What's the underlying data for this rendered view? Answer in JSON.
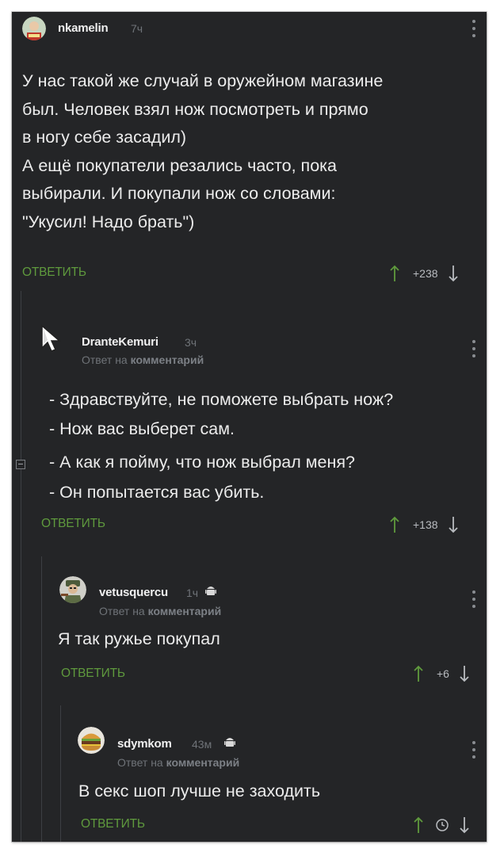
{
  "colors": {
    "background": "#242527",
    "reply_green": "#5f9a3d",
    "username": "#f0f0f0",
    "muted": "#6f7378",
    "body_text": "#ececec"
  },
  "comments": [
    {
      "username": "nkamelin",
      "time": "7ч",
      "avatar_icon": "user-avatar-icon",
      "lines": [
        "У нас такой же случай в оружейном магазине",
        "был. Человек взял нож посмотреть и прямо",
        "в ногу себе засадил)",
        "А ещё покупатели резались часто, пока",
        "выбирали. И покупали нож со словами:",
        "\"Укусил! Надо брать\")"
      ],
      "reply_label": "ОТВЕТИТЬ",
      "score": "+238"
    },
    {
      "username": "DranteKemuri",
      "time": "3ч",
      "avatar_icon": "cursor-avatar-icon",
      "reply_to_prefix": "Ответ на",
      "reply_to_target": "комментарий",
      "lines": [
        "- Здравствуйте, не поможете выбрать нож?",
        "- Нож вас выберет сам.",
        "- А как я пойму, что нож выбрал меня?",
        "- Он попытается вас убить."
      ],
      "reply_label": "ОТВЕТИТЬ",
      "score": "+138"
    },
    {
      "username": "vetusquercu",
      "time": "1ч",
      "avatar_icon": "soldier-avatar-icon",
      "device_icon": "android-icon",
      "reply_to_prefix": "Ответ на",
      "reply_to_target": "комментарий",
      "lines": [
        "Я так ружье покупал"
      ],
      "reply_label": "ОТВЕТИТЬ",
      "score": "+6"
    },
    {
      "username": "sdymkom",
      "time": "43м",
      "avatar_icon": "burger-avatar-icon",
      "device_icon": "android-icon",
      "reply_to_prefix": "Ответ на",
      "reply_to_target": "комментарий",
      "lines": [
        "В секс шоп лучше не заходить"
      ],
      "reply_label": "ОТВЕТИТЬ",
      "score_icon": "clock-icon"
    }
  ]
}
